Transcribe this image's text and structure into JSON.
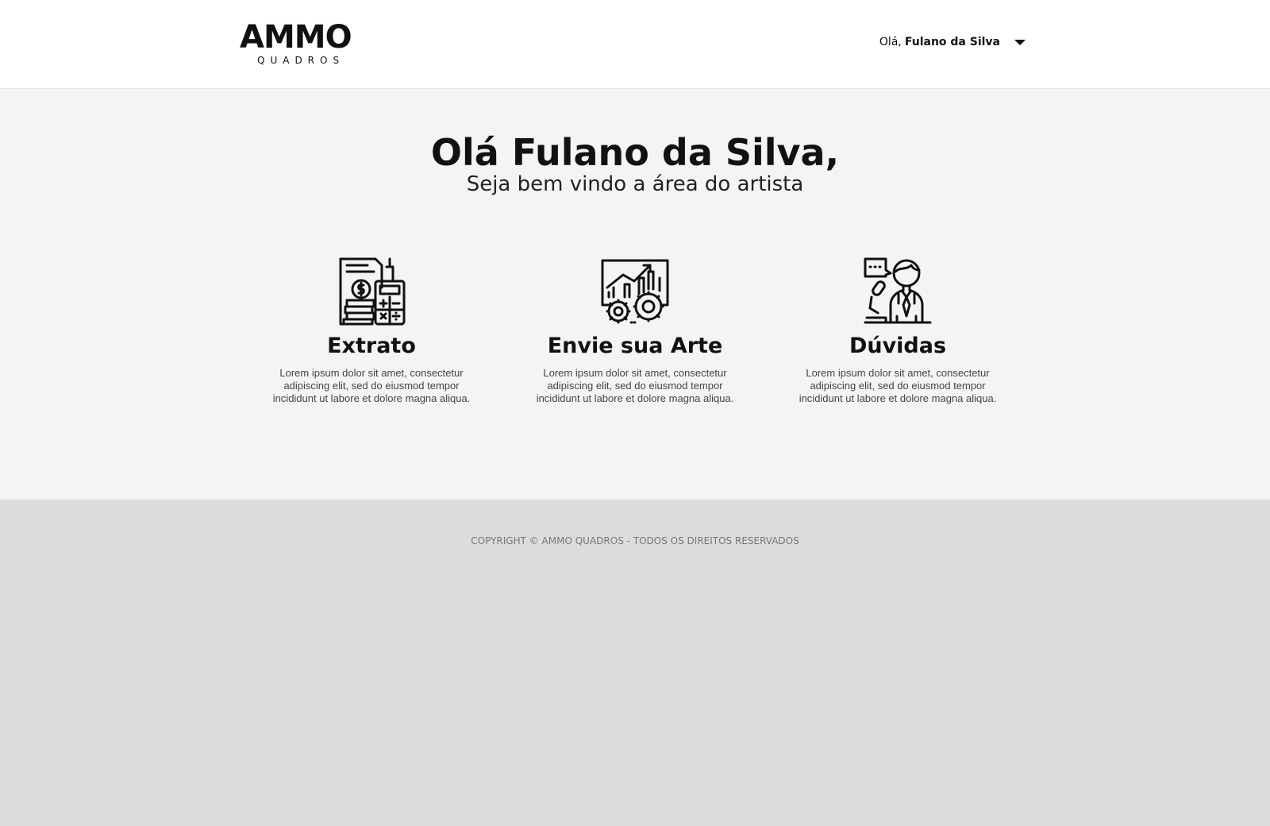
{
  "header": {
    "logo": {
      "mark": "AMMO",
      "sub": "QUADROS"
    },
    "user_menu": {
      "greeting": "Olá,",
      "name": "Fulano da Silva",
      "icon": "caret-down-icon"
    }
  },
  "hero": {
    "title": "Olá Fulano da Silva,",
    "subtitle": "Seja bem vindo a área do artista"
  },
  "cards": [
    {
      "icon": "invoice-calculator-icon",
      "title": "Extrato",
      "description": "Lorem ipsum dolor sit amet, consectetur adipiscing elit, sed do eiusmod tempor incididunt ut labore et dolore magna aliqua."
    },
    {
      "icon": "presentation-chart-gears-icon",
      "title": "Envie sua Arte",
      "description": "Lorem ipsum dolor sit amet, consectetur adipiscing elit, sed do eiusmod tempor incididunt ut labore et dolore magna aliqua."
    },
    {
      "icon": "speaker-microphone-icon",
      "title": "Dúvidas",
      "description": "Lorem ipsum dolor sit amet, consectetur adipiscing elit, sed do eiusmod tempor incididunt ut labore et dolore magna aliqua."
    }
  ],
  "footer": {
    "copyright": "COPYRIGHT © AMMO QUADROS - TODOS OS DIREITOS RESERVADOS"
  },
  "colors": {
    "header_bg": "#ffffff",
    "main_bg": "#f4f4f4",
    "footer_bg": "#dcdcdc",
    "text": "#111111"
  }
}
